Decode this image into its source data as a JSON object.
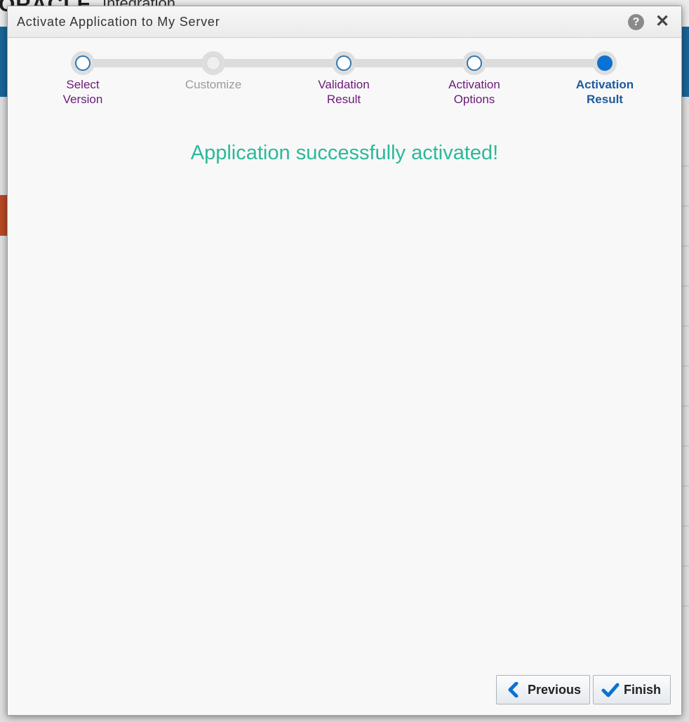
{
  "background": {
    "brand": "ORACLE",
    "product": "Integration"
  },
  "dialog": {
    "title": "Activate Application to My Server",
    "help_icon": "?",
    "close_icon": "✕"
  },
  "train": {
    "steps": [
      {
        "label": "Select\nVersion",
        "state": "visited"
      },
      {
        "label": "Customize",
        "state": "disabled"
      },
      {
        "label": "Validation\nResult",
        "state": "visited"
      },
      {
        "label": "Activation\nOptions",
        "state": "visited"
      },
      {
        "label": "Activation\nResult",
        "state": "current"
      }
    ]
  },
  "message": "Application successfully activated!",
  "buttons": {
    "previous": "Previous",
    "finish": "Finish"
  },
  "icons": {
    "help": "help-icon",
    "close": "close-icon",
    "previous": "chevron-left-icon",
    "finish": "checkmark-icon"
  },
  "colors": {
    "success": "#2bb99a",
    "current_step": "#1d5a9c",
    "visited_step": "#6b1a78",
    "disabled_step": "#9a9a9a",
    "accent_blue": "#0a72d3",
    "brand_band": "#1c6fa8"
  }
}
